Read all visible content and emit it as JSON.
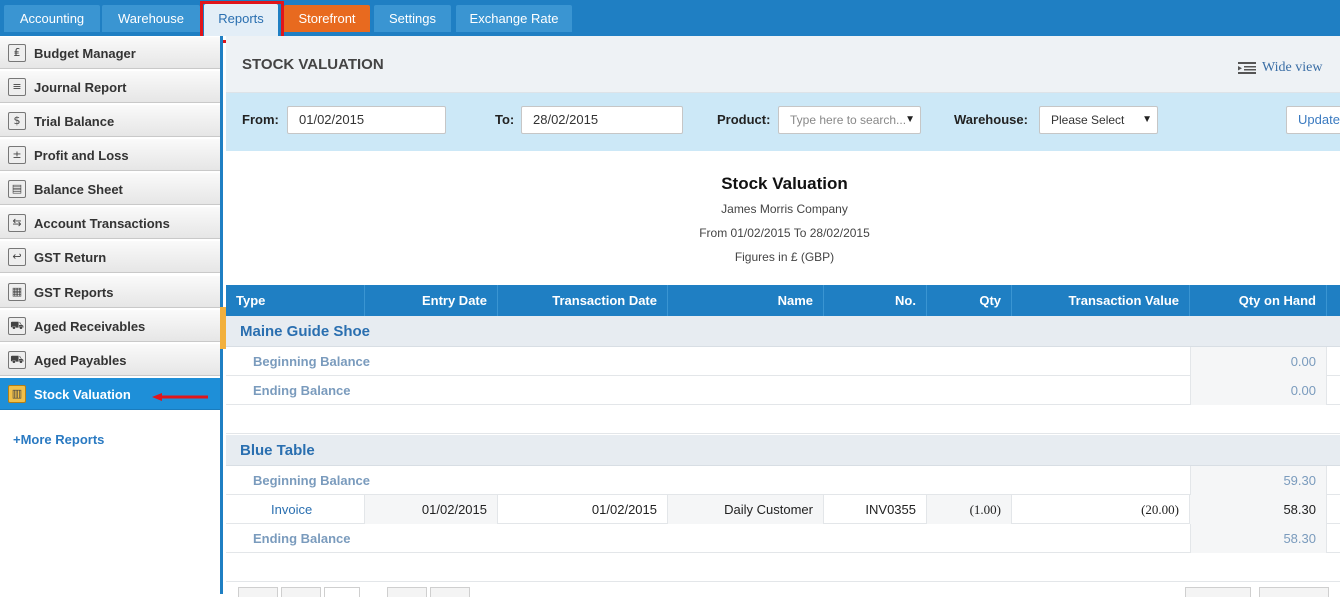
{
  "nav": {
    "tabs": [
      {
        "label": "Accounting"
      },
      {
        "label": "Warehouse"
      },
      {
        "label": "Reports"
      },
      {
        "label": "Storefront"
      },
      {
        "label": "Settings"
      },
      {
        "label": "Exchange Rate"
      }
    ]
  },
  "sidebar": {
    "items": [
      {
        "label": "Budget Manager",
        "icon": "budget-icon"
      },
      {
        "label": "Journal Report",
        "icon": "journal-icon"
      },
      {
        "label": "Trial Balance",
        "icon": "dollar-icon"
      },
      {
        "label": "Profit and Loss",
        "icon": "calculator-icon"
      },
      {
        "label": "Balance Sheet",
        "icon": "sheet-icon"
      },
      {
        "label": "Account Transactions",
        "icon": "transactions-icon"
      },
      {
        "label": "GST Return",
        "icon": "return-icon"
      },
      {
        "label": "GST Reports",
        "icon": "reports-icon"
      },
      {
        "label": "Aged Receivables",
        "icon": "car-icon"
      },
      {
        "label": "Aged Payables",
        "icon": "car-icon"
      },
      {
        "label": "Stock Valuation",
        "icon": "stock-icon"
      }
    ],
    "more_reports": "+More Reports"
  },
  "header": {
    "title": "STOCK VALUATION",
    "wide_view": "Wide view"
  },
  "filters": {
    "from_label": "From:",
    "from_value": "01/02/2015",
    "to_label": "To:",
    "to_value": "28/02/2015",
    "product_label": "Product:",
    "product_placeholder": "Type here to search...",
    "warehouse_label": "Warehouse:",
    "warehouse_value": "Please Select",
    "update_label": "Update"
  },
  "report": {
    "title": "Stock Valuation",
    "company": "James Morris Company",
    "period": "From 01/02/2015 To 28/02/2015",
    "currency": "Figures in £ (GBP)"
  },
  "table": {
    "columns": [
      "Type",
      "Entry Date",
      "Transaction Date",
      "Name",
      "No.",
      "Qty",
      "Transaction Value",
      "Qty on Hand"
    ],
    "groups": [
      {
        "name": "Maine Guide Shoe",
        "beginning_label": "Beginning Balance",
        "beginning_value": "0.00",
        "rows": [],
        "ending_label": "Ending Balance",
        "ending_value": "0.00"
      },
      {
        "name": "Blue Table",
        "beginning_label": "Beginning Balance",
        "beginning_value": "59.30",
        "rows": [
          {
            "type": "Invoice",
            "entry_date": "01/02/2015",
            "transaction_date": "01/02/2015",
            "name": "Daily Customer",
            "no": "INV0355",
            "qty": "(1.00)",
            "transaction_value": "(20.00)",
            "qty_on_hand": "58.30"
          }
        ],
        "ending_label": "Ending Balance",
        "ending_value": "58.30"
      }
    ]
  },
  "colors": {
    "nav_bg": "#1f7fc3",
    "storefront": "#e86a1f",
    "highlight": "#e0151b",
    "active_sidebar": "#1e8fd8"
  }
}
